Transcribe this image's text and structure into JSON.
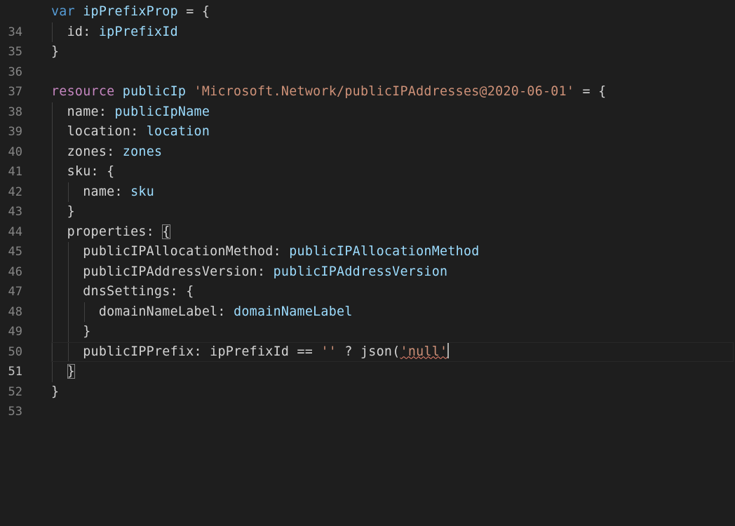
{
  "editor": {
    "lines": [
      {
        "num": "34",
        "tokens": [
          "var",
          "ipPrefixProp",
          "= {"
        ]
      },
      {
        "num": "35",
        "tokens": [
          "id:",
          "ipPrefixId"
        ]
      },
      {
        "num": "36",
        "tokens": [
          "}"
        ]
      },
      {
        "num": "37",
        "tokens": []
      },
      {
        "num": "38",
        "tokens": [
          "resource",
          "publicIp",
          "'Microsoft.Network/publicIPAddresses@2020-06-01'",
          "= {"
        ]
      },
      {
        "num": "39",
        "tokens": [
          "name:",
          "publicIpName"
        ]
      },
      {
        "num": "40",
        "tokens": [
          "location:",
          "location"
        ]
      },
      {
        "num": "41",
        "tokens": [
          "zones:",
          "zones"
        ]
      },
      {
        "num": "42",
        "tokens": [
          "sku: {"
        ]
      },
      {
        "num": "43",
        "tokens": [
          "name:",
          "sku"
        ]
      },
      {
        "num": "44",
        "tokens": [
          "}"
        ]
      },
      {
        "num": "45",
        "tokens": [
          "properties:",
          "{"
        ]
      },
      {
        "num": "46",
        "tokens": [
          "publicIPAllocationMethod:",
          "publicIPAllocationMethod"
        ]
      },
      {
        "num": "47",
        "tokens": [
          "publicIPAddressVersion:",
          "publicIPAddressVersion"
        ]
      },
      {
        "num": "48",
        "tokens": [
          "dnsSettings: {"
        ]
      },
      {
        "num": "49",
        "tokens": [
          "domainNameLabel:",
          "domainNameLabel"
        ]
      },
      {
        "num": "50",
        "tokens": [
          "}"
        ]
      },
      {
        "num": "51",
        "tokens": [
          "publicIPPrefix: ipPrefixId ==",
          "''",
          "? json(",
          "'null'"
        ]
      },
      {
        "num": "52",
        "tokens": [
          "}"
        ]
      },
      {
        "num": "53",
        "tokens": [
          "}"
        ]
      }
    ]
  },
  "colors": {
    "background": "#1e1e1e",
    "keyword": "#c586c0",
    "variable": "#9cdcfe",
    "string": "#ce9178",
    "text": "#d4d4d4",
    "line_number": "#858585",
    "current_line_number": "#c6c6c6"
  }
}
